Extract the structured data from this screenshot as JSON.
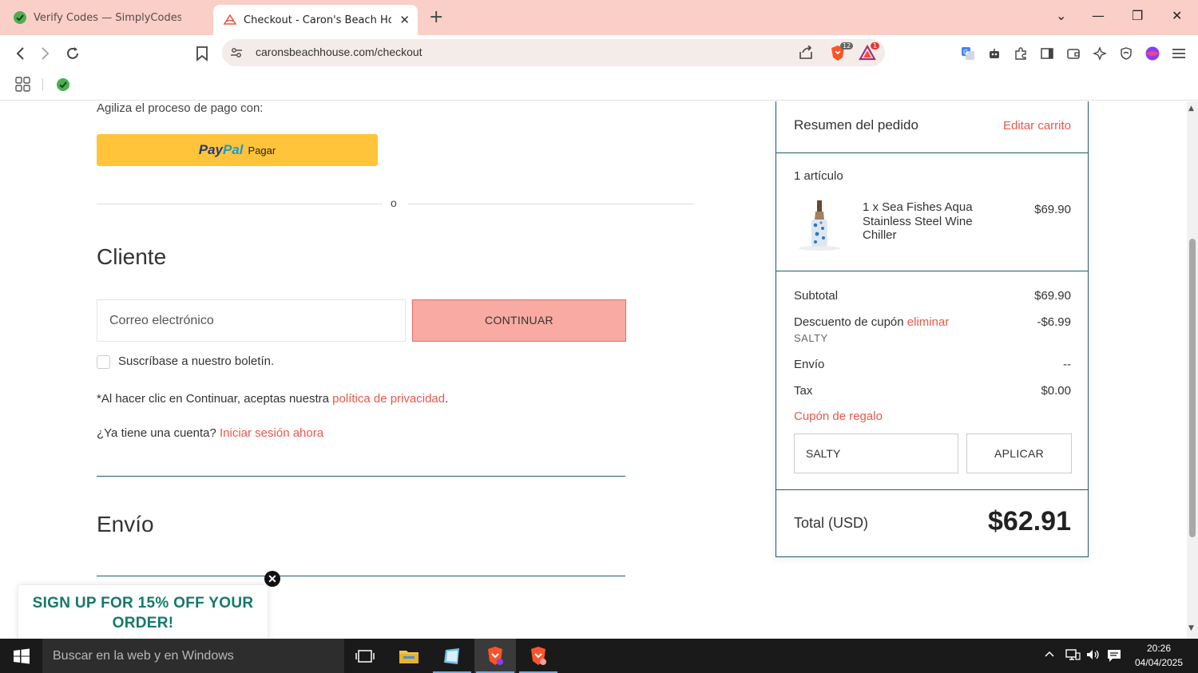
{
  "browser": {
    "tabs": [
      {
        "title": "Verify Codes — SimplyCodes",
        "active": false
      },
      {
        "title": "Checkout - Caron's Beach House",
        "active": true
      }
    ],
    "url": "caronsbeachhouse.com/checkout",
    "brave_shield_count": "12",
    "rewards_count": "1"
  },
  "checkout": {
    "express_label": "Agiliza el proceso de pago con:",
    "paypal": {
      "brand1": "Pay",
      "brand2": "Pal",
      "label": "Pagar"
    },
    "or_label": "o",
    "customer": {
      "heading": "Cliente",
      "email_placeholder": "Correo electrónico",
      "continue_label": "CONTINUAR",
      "newsletter_label": "Suscríbase a nuestro boletín.",
      "terms_prefix": "*Al hacer clic en Continuar, aceptas nuestra ",
      "terms_link": "política de privacidad",
      "terms_suffix": ".",
      "account_prefix": "¿Ya tiene una cuenta? ",
      "account_link": "Iniciar sesión ahora"
    },
    "shipping_heading": "Envío"
  },
  "popup": {
    "text": "SIGN UP FOR 15% OFF YOUR ORDER!",
    "close_glyph": "✕"
  },
  "summary": {
    "heading": "Resumen del pedido",
    "edit_label": "Editar carrito",
    "items_count": "1 artículo",
    "product": {
      "name": "1 x Sea Fishes Aqua Stainless Steel Wine Chiller",
      "price": "$69.90"
    },
    "subtotal_label": "Subtotal",
    "subtotal_value": "$69.90",
    "discount_label": "Descuento de cupón",
    "discount_remove": "eliminar",
    "discount_value": "-$6.99",
    "coupon_code": "SALTY",
    "shipping_label": "Envío",
    "shipping_value": "--",
    "tax_label": "Tax",
    "tax_value": "$0.00",
    "gift_label": "Cupón de regalo",
    "gift_input_value": "SALTY",
    "apply_label": "APLICAR",
    "total_label": "Total (USD)",
    "total_value": "$62.91"
  },
  "taskbar": {
    "search_placeholder": "Buscar en la web y en Windows",
    "time": "20:26",
    "date": "04/04/2025"
  },
  "colors": {
    "accent": "#e8574a",
    "tabbar": "#f9cfc7",
    "continue_bg": "#f9aaa2",
    "paypal": "#ffc439",
    "summary_border": "#1f5b6e",
    "popup_text": "#137a6b"
  }
}
